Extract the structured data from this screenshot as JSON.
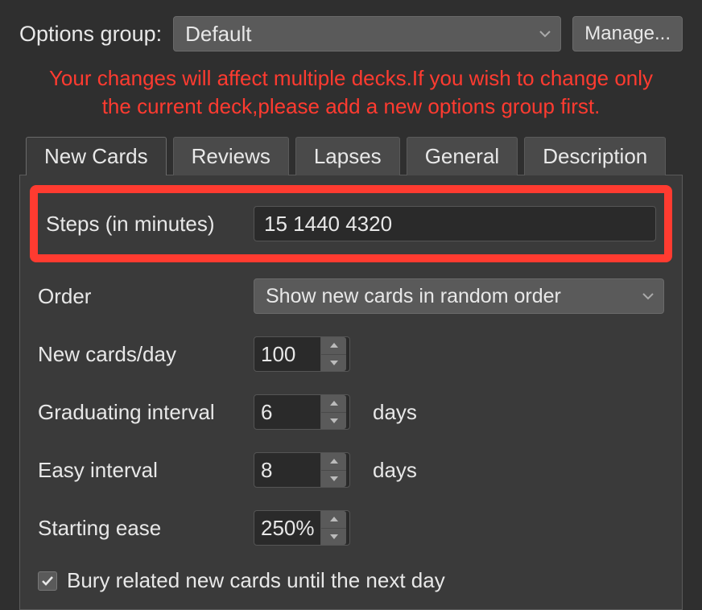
{
  "top": {
    "label": "Options group:",
    "group_value": "Default",
    "manage_label": "Manage..."
  },
  "warning": {
    "line1": "Your changes will affect multiple decks.If you wish to change only",
    "line2": "the current deck,please add a new options group first."
  },
  "tabs": [
    "New Cards",
    "Reviews",
    "Lapses",
    "General",
    "Description"
  ],
  "fields": {
    "steps_label": "Steps (in minutes)",
    "steps_value": "15 1440 4320",
    "order_label": "Order",
    "order_value": "Show new cards in random order",
    "newcards_label": "New cards/day",
    "newcards_value": "100",
    "grad_label": "Graduating interval",
    "grad_value": "6",
    "grad_unit": "days",
    "easy_label": "Easy interval",
    "easy_value": "8",
    "easy_unit": "days",
    "ease_label": "Starting ease",
    "ease_value": "250%",
    "bury_label": "Bury related new cards until the next day",
    "bury_checked": true
  }
}
